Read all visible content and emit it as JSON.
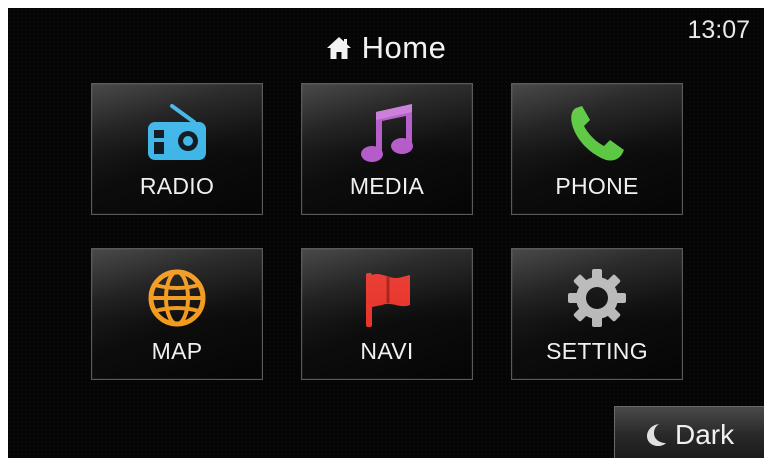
{
  "header": {
    "title": "Home",
    "home_icon": "home-icon",
    "clock": "13:07"
  },
  "tiles": [
    {
      "label": "RADIO",
      "icon": "radio-icon",
      "color": "#3fb6e8"
    },
    {
      "label": "MEDIA",
      "icon": "music-note-icon",
      "color": "#b45cc9"
    },
    {
      "label": "PHONE",
      "icon": "phone-icon",
      "color": "#5cc842"
    },
    {
      "label": "MAP",
      "icon": "globe-icon",
      "color": "#f29a1e"
    },
    {
      "label": "NAVI",
      "icon": "flag-icon",
      "color": "#e8352c"
    },
    {
      "label": "SETTING",
      "icon": "gear-icon",
      "color": "#b9b9b9"
    }
  ],
  "footer": {
    "dark_label": "Dark",
    "dark_icon": "moon-icon"
  }
}
